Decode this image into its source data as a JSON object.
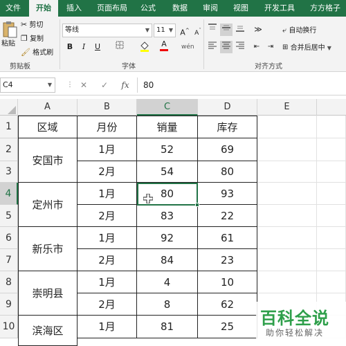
{
  "tabs": [
    "文件",
    "开始",
    "插入",
    "页面布局",
    "公式",
    "数据",
    "审阅",
    "视图",
    "开发工具",
    "方方格子"
  ],
  "active_tab": "开始",
  "ribbon": {
    "clipboard": {
      "paste": "粘贴",
      "cut": "剪切",
      "copy": "复制",
      "format_painter": "格式刷",
      "label": "剪贴板"
    },
    "font": {
      "name": "等线",
      "size": "11",
      "grow": "A",
      "shrink": "A",
      "bold": "B",
      "italic": "I",
      "underline": "U",
      "font_color_glyph": "A",
      "label": "字体"
    },
    "alignment": {
      "wrap": "自动换行",
      "merge": "合并后居中",
      "label": "对齐方式"
    }
  },
  "formula_bar": {
    "name_box": "C4",
    "cancel": "✕",
    "enter": "✓",
    "fx": "fx",
    "value": "80"
  },
  "columns": [
    "A",
    "B",
    "C",
    "D",
    "E"
  ],
  "rows": [
    "1",
    "2",
    "3",
    "4",
    "5",
    "6",
    "7",
    "8",
    "9",
    "10"
  ],
  "header": {
    "region": "区域",
    "month": "月份",
    "sales": "销量",
    "stock": "库存"
  },
  "regions": [
    "安国市",
    "定州市",
    "新乐市",
    "崇明县",
    "滨海区"
  ],
  "data_rows": [
    {
      "month": "1月",
      "sales": "52",
      "stock": "69"
    },
    {
      "month": "2月",
      "sales": "54",
      "stock": "80"
    },
    {
      "month": "1月",
      "sales": "80",
      "stock": "93"
    },
    {
      "month": "2月",
      "sales": "83",
      "stock": "22"
    },
    {
      "month": "1月",
      "sales": "92",
      "stock": "61"
    },
    {
      "month": "2月",
      "sales": "84",
      "stock": "23"
    },
    {
      "month": "1月",
      "sales": "4",
      "stock": "10"
    },
    {
      "month": "2月",
      "sales": "8",
      "stock": "62"
    },
    {
      "month": "1月",
      "sales": "81",
      "stock": "25"
    }
  ],
  "watermark": {
    "main": "百科全说",
    "sub": "助你轻松解决"
  },
  "colors": {
    "accent": "#217346",
    "watermark": "#2e9f4a"
  }
}
